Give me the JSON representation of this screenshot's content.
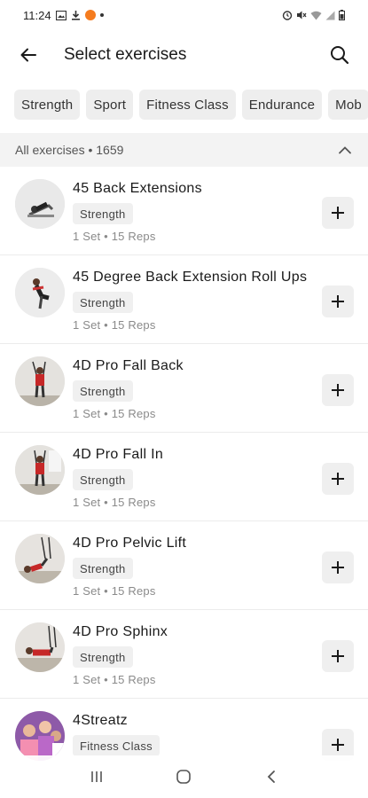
{
  "status_bar": {
    "time": "11:24",
    "left_icons": [
      "image-icon",
      "download-icon",
      "notification-badge-icon",
      "dot-icon"
    ],
    "right_icons": [
      "alarm-icon",
      "mute-icon",
      "wifi-icon",
      "signal-icon",
      "battery-icon"
    ]
  },
  "app_bar": {
    "title": "Select exercises",
    "back_icon": "arrow-left-icon",
    "search_icon": "search-icon"
  },
  "filters": [
    "Strength",
    "Sport",
    "Fitness Class",
    "Endurance",
    "Mob"
  ],
  "section": {
    "label": "All exercises • 1659",
    "toggle_icon": "chevron-up-icon"
  },
  "exercises": [
    {
      "name": "45 Back Extensions",
      "tag": "Strength",
      "meta": "1 Set • 15 Reps"
    },
    {
      "name": "45 Degree Back Extension Roll Ups",
      "tag": "Strength",
      "meta": "1 Set • 15 Reps"
    },
    {
      "name": "4D Pro Fall Back",
      "tag": "Strength",
      "meta": "1 Set • 15 Reps"
    },
    {
      "name": "4D Pro Fall In",
      "tag": "Strength",
      "meta": "1 Set • 15 Reps"
    },
    {
      "name": "4D Pro Pelvic Lift",
      "tag": "Strength",
      "meta": "1 Set • 15 Reps"
    },
    {
      "name": "4D Pro Sphinx",
      "tag": "Strength",
      "meta": "1 Set • 15 Reps"
    },
    {
      "name": "4Streatz",
      "tag": "Fitness Class",
      "meta": ""
    }
  ],
  "nav_bar": {
    "icons": [
      "recent-apps-icon",
      "home-icon",
      "back-icon"
    ]
  },
  "colors": {
    "chip_bg": "#eeeeee",
    "section_bg": "#f3f3f3",
    "badge_orange": "#f57c1f",
    "add_button_bg": "#efefef"
  }
}
